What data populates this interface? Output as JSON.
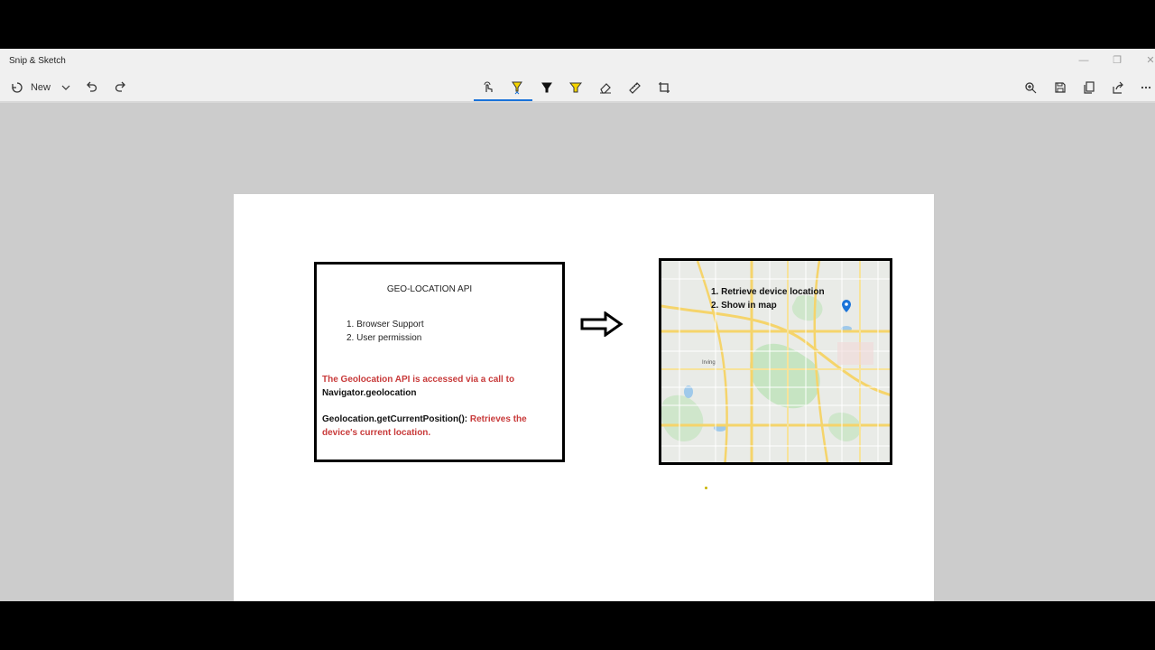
{
  "window": {
    "title": "Snip & Sketch",
    "controls": [
      "—",
      "❐",
      "✕"
    ]
  },
  "toolbar": {
    "new_label": "New",
    "left_icons": [
      "new-snip-icon",
      "chevron-down-icon",
      "undo-icon",
      "redo-icon"
    ],
    "center_tools": [
      "touch-writing-icon",
      "ballpoint-pen-icon",
      "pencil-icon",
      "highlighter-icon",
      "eraser-icon",
      "ruler-icon",
      "crop-icon"
    ],
    "right_icons": [
      "zoom-icon",
      "save-icon",
      "copy-icon",
      "share-icon",
      "more-icon"
    ],
    "active_tool": "ballpoint-pen-icon",
    "accent_color": "#1a73d9"
  },
  "slide": {
    "left_box": {
      "title": "GEO-LOCATION API",
      "list": [
        "1. Browser Support",
        "2. User permission"
      ],
      "para1_red": "The Geolocation API is accessed via a call to",
      "para1_black": "Navigator.geolocation",
      "para2_black": "Geolocation.getCurrentPosition():",
      "para2_red": "Retrieves the device's current location."
    },
    "right_box": {
      "steps": [
        "1. Retrieve device location",
        "2. Show in map"
      ],
      "map_labels": [
        "Irving"
      ]
    }
  },
  "colors": {
    "red_text": "#c83a3a",
    "map_road": "#f5d46b",
    "map_green": "#c6e4c2",
    "map_water": "#9fc9ea",
    "pin": "#1a73d9"
  }
}
